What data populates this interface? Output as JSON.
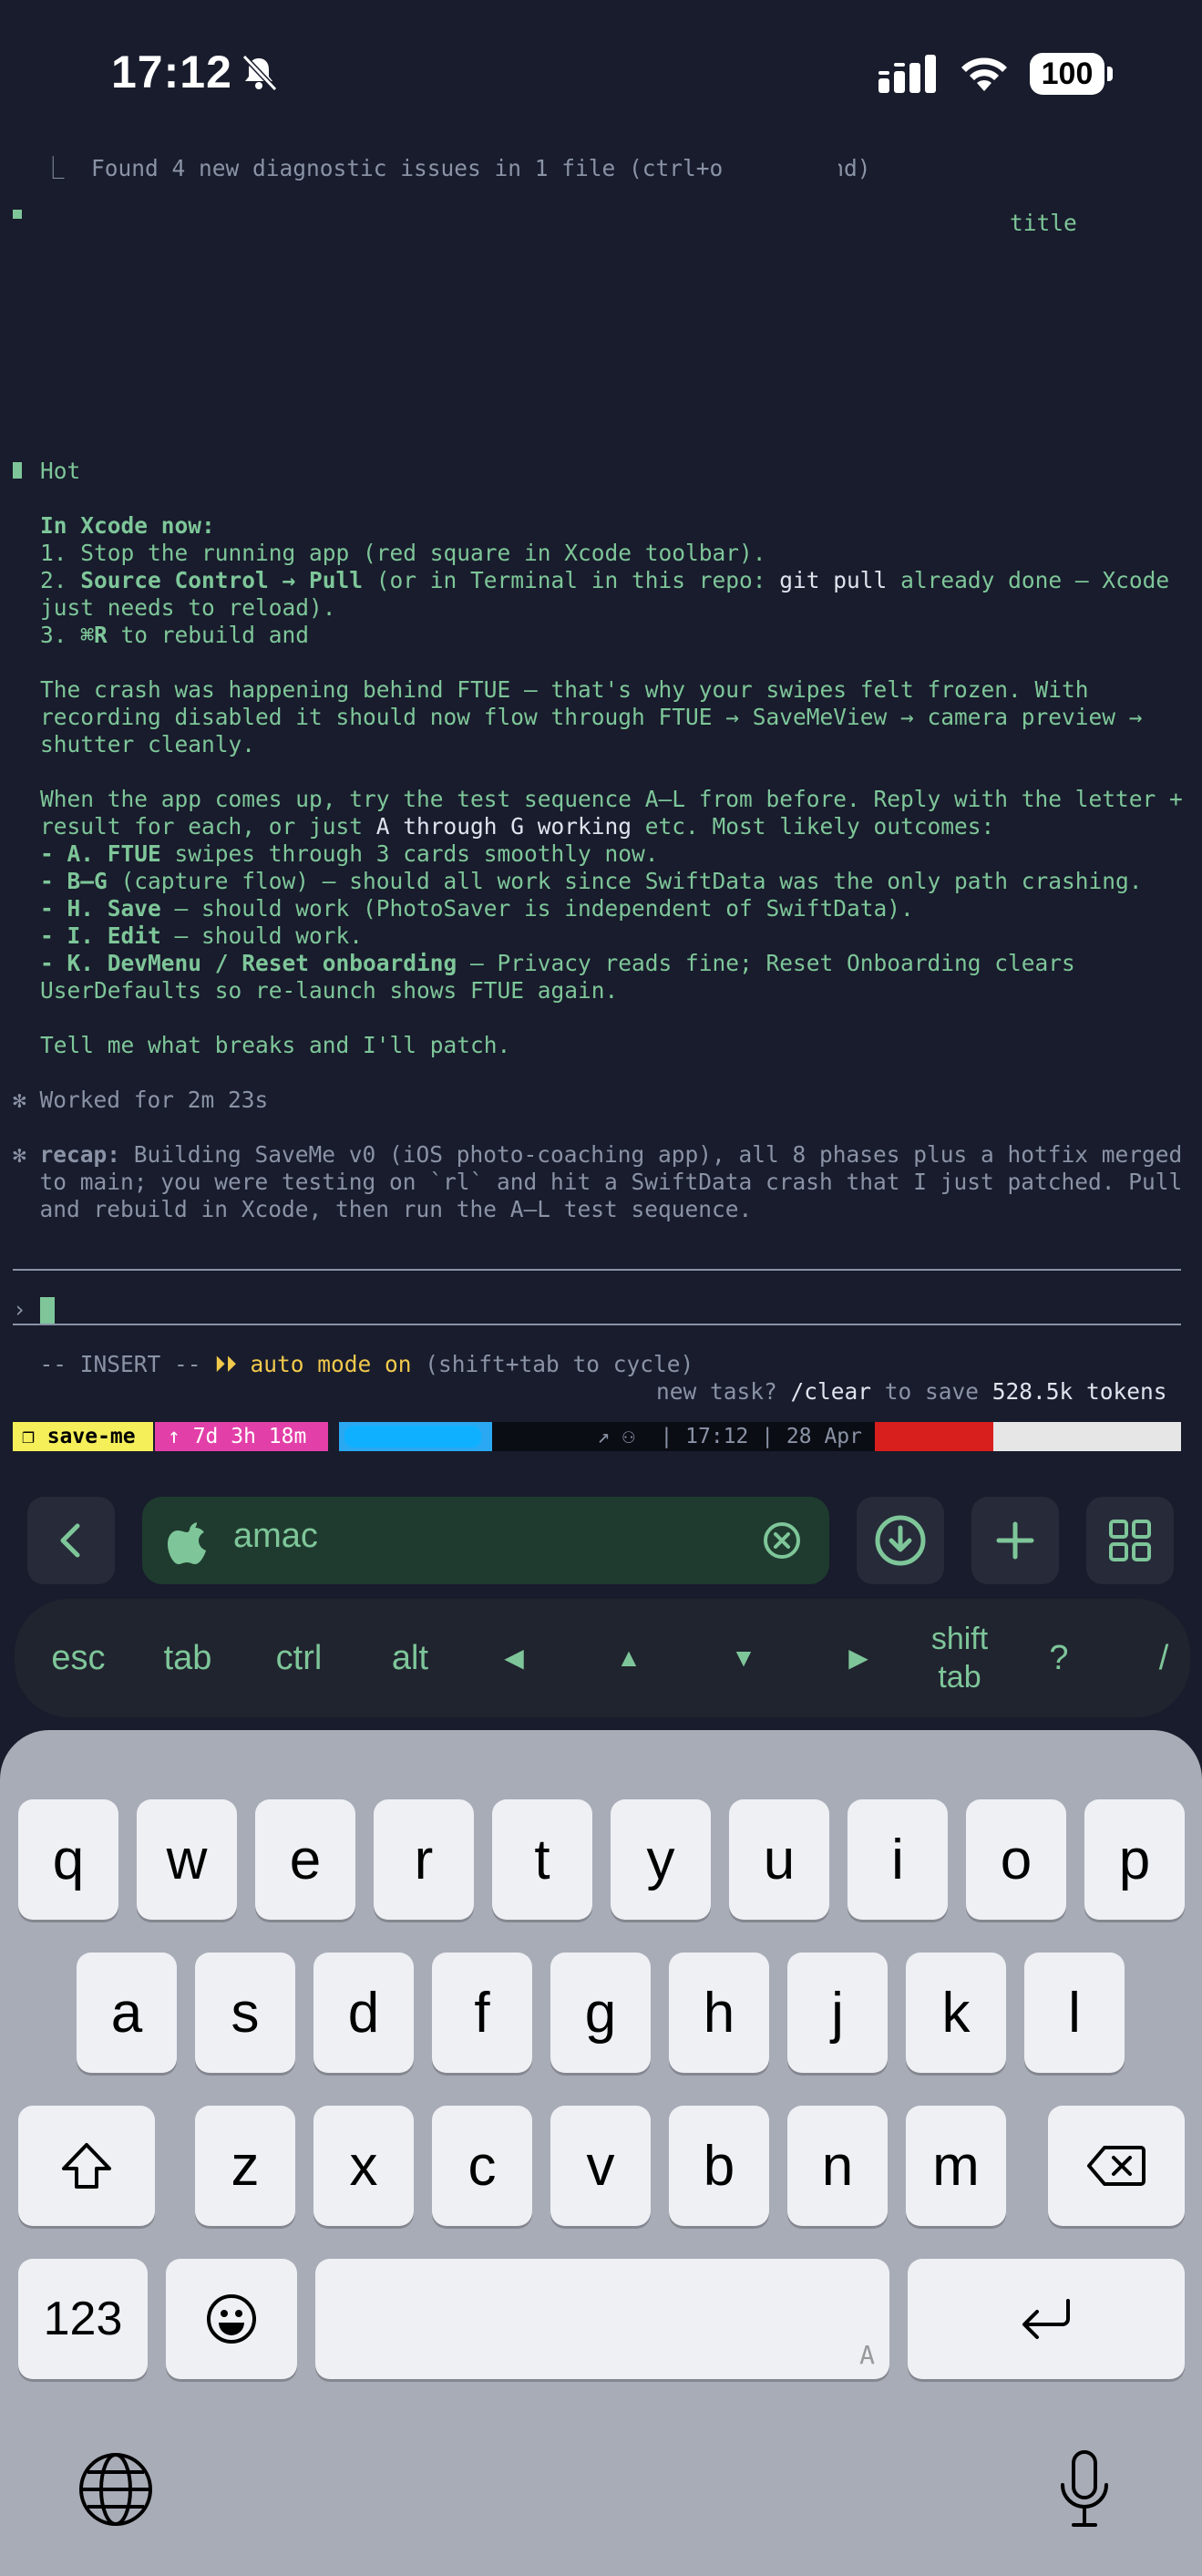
{
  "status_bar": {
    "time": "17:12",
    "battery": "100",
    "icons": [
      "bell-slash-icon",
      "cellular-signal-icon",
      "wifi-icon",
      "battery-icon"
    ]
  },
  "terminal": {
    "diagnostic_line": "⎿  Found 4 new diagnostic issues in 1 file (ctrl+o to expand)",
    "partial_right": "title",
    "partial_left": "Hot",
    "in_xcode_heading": "In Xcode now:",
    "step1": "1. Stop the running app (red square in Xcode toolbar).",
    "step2_num": "2. ",
    "step2_bold": "Source Control → Pull",
    "step2_rest": " (or in Terminal in this repo: ",
    "step2_cmd": "git pull",
    "step2_tail": " already done — Xcode",
    "step2_cont": "just needs to reload).",
    "step3_num": "3. ",
    "step3_key": "⌘R",
    "step3_rest": " to rebuild and",
    "crash_p1": "The crash was happening behind FTUE — that's why your swipes felt frozen. With",
    "crash_p2": "recording disabled it should now flow through FTUE → SaveMeView → camera preview →",
    "crash_p3": "shutter cleanly.",
    "when_p1": "When the app comes up, try the test sequence A–L from before. Reply with the letter +",
    "when_p2a": "result for each, or just ",
    "when_p2b": "A through G working",
    "when_p2c": " etc. Most likely outcomes:",
    "bul_a_b": "- A. FTUE",
    "bul_a_r": " swipes through 3 cards smoothly now.",
    "bul_bg_b": "- B–G",
    "bul_bg_r": " (capture flow) — should all work since SwiftData was the only path crashing.",
    "bul_h_b": "- H. Save",
    "bul_h_r": " — should work (PhotoSaver is independent of SwiftData).",
    "bul_i_b": "- I. Edit",
    "bul_i_r": " — should work.",
    "bul_k_b": "- K. DevMenu / Reset onboarding",
    "bul_k_r": " — Privacy reads fine; Reset Onboarding clears",
    "bul_k_cont": "UserDefaults so re-launch shows FTUE again.",
    "tell_me": "Tell me what breaks and I'll patch.",
    "worked_for": "✻ Worked for 2m 23s",
    "recap_star": "✻ ",
    "recap_label": "recap:",
    "recap_1": " Building SaveMe v0 (iOS photo-coaching app), all 8 phases plus a hotfix merged",
    "recap_2": "  to main; you were testing on `rl` and hit a SwiftData crash that I just patched. Pull",
    "recap_3": "  and rebuild in Xcode, then run the A–L test sequence.",
    "prompt": "›",
    "mode_prefix": "  -- INSERT -- ",
    "mode_auto": "⏵⏵ auto mode on",
    "mode_suffix": " (shift+tab to cycle)",
    "hint_a": "new task? ",
    "hint_b": "/clear",
    "hint_c": " to save ",
    "hint_d": "528.5k tokens"
  },
  "tmux": {
    "session": "❐ save-me",
    "uptime": "↑ 7d 3h 18m",
    "mid": "↗ ⚇  | 17:12 | 28 Apr"
  },
  "accessory": {
    "url_text": "amac",
    "keys": [
      "esc",
      "tab",
      "ctrl",
      "alt",
      "◀",
      "▲",
      "▼",
      "▶",
      "shift tab",
      "?",
      "/"
    ]
  },
  "keyboard": {
    "row1": [
      "q",
      "w",
      "e",
      "r",
      "t",
      "y",
      "u",
      "i",
      "o",
      "p"
    ],
    "row2": [
      "a",
      "s",
      "d",
      "f",
      "g",
      "h",
      "j",
      "k",
      "l"
    ],
    "row3": [
      "z",
      "x",
      "c",
      "v",
      "b",
      "n",
      "m"
    ],
    "numbers_key": "123",
    "space_hint": "A"
  },
  "colors": {
    "terminal_bg": "#181c2c",
    "terminal_green": "#7ec699",
    "tmux_yellow": "#f5f05a",
    "tmux_magenta": "#e23fa8",
    "tmux_blue": "#2aa8f2",
    "tmux_red": "#d91e1e"
  }
}
